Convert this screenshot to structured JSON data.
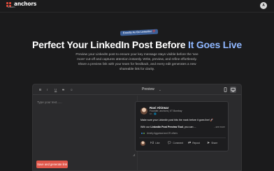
{
  "brand": {
    "name": "anchors",
    "sub": "Linkedin"
  },
  "user": {
    "initials": "A"
  },
  "badge": "Exactly As On LinkedIn! 💯",
  "hero": {
    "title_part1": "Perfect Your LinkedIn Post Before ",
    "title_accent": "It Goes Live",
    "subtitle": "Preview your LinkedIn post to ensure your key message stays visible before the 'see more' cut-off and captures attention instantly. Write, preview, and refine effortlessly. Share a preview link with your team for feedback, and every edit generates a new shareable link for clarity."
  },
  "toolbar": {
    "bold": "B",
    "italic": "I",
    "underline": "U",
    "strike": "S",
    "emoji": "☺",
    "preview_label": "Preview"
  },
  "editor": {
    "placeholder": "Type your text......",
    "generate_button": "Save and generate link"
  },
  "post": {
    "author": "Ravi Ahirwar",
    "role": "Founder, anchors | IIT Bombay",
    "time": "1h · 🌐",
    "line1": "Make sure your LinkedIn post hits the mark before it goes live! 🚀",
    "line2_prefix": "With our ",
    "line2_bold": "LinkedIn Post Preview Tool",
    "line2_suffix": ", you can ...",
    "see_more": "...see more",
    "reactions": "Ameliy Aggarwal and 29 others",
    "actions": {
      "like": "Like",
      "comment": "Comment",
      "repost": "Repost",
      "share": "Share"
    }
  },
  "colors": {
    "accent": "#8fb7ff",
    "cta": "#e0574b",
    "badge": "#3c5f97",
    "logo": "#e04a3a"
  }
}
